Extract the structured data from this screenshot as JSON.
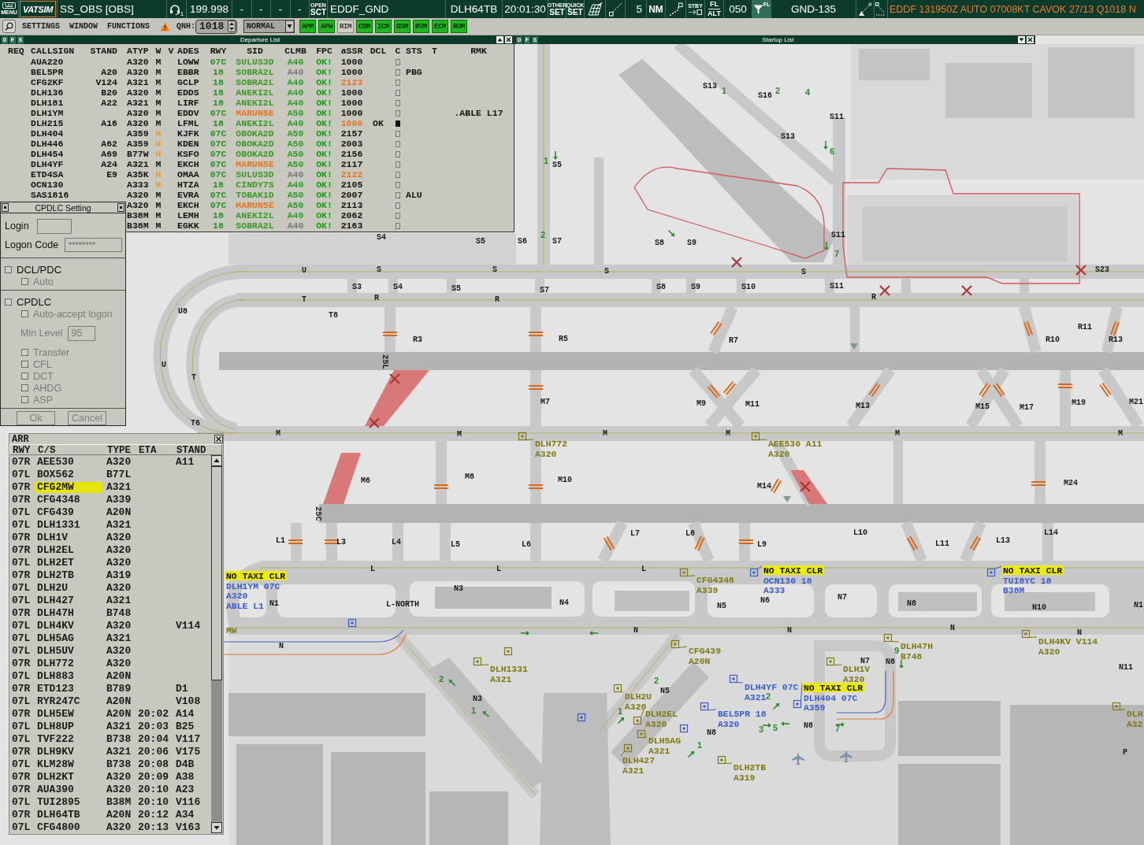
{
  "top_bar": {
    "menu": "MENU",
    "logo": "VATSIM",
    "callsign": "SS_OBS [OBS]",
    "headset_index": "1",
    "frequency": "199.998",
    "slots": [
      "-",
      "-",
      "-",
      "-"
    ],
    "sector": [
      "OPEN",
      "SCT"
    ],
    "position": "EDDF_GND",
    "aircraft": "DLH64TB",
    "clock": "20:01:30",
    "other_set": [
      "OTHER",
      "SET"
    ],
    "quick_set": [
      "QUICK",
      "SET"
    ],
    "range": "5",
    "range_unit": "NM",
    "standby": "STBY",
    "altitude_mode": [
      "FL",
      "ALT"
    ],
    "filter_level": "050",
    "filter_label": "FL",
    "filter_active": true,
    "atc_station": "GND-135",
    "metar": "EDDF 131950Z AUTO 07008KT CAVOK 27/13 Q1018 N"
  },
  "toolbar": {
    "menus": [
      "SETTINGS",
      "WINDOW",
      "FUNCTIONS"
    ],
    "qnh_label": "QNH:",
    "qnh": "1018",
    "mode": "NORMAL",
    "toggles": [
      {
        "label": "APM",
        "on": true
      },
      {
        "label": "APW",
        "on": true
      },
      {
        "label": "RIM",
        "on": false
      },
      {
        "label": "CBM",
        "on": true
      },
      {
        "label": "ICM",
        "on": true
      },
      {
        "label": "OSM",
        "on": true
      },
      {
        "label": "RVM",
        "on": true
      },
      {
        "label": "ECM",
        "on": true
      },
      {
        "label": "RUM",
        "on": true
      }
    ]
  },
  "departure_list": {
    "flags": [
      "O",
      "F",
      "S"
    ],
    "title": "Departure List",
    "collapsed": false,
    "columns": [
      "REQ",
      "CALLSIGN",
      "STAND",
      "ATYP",
      "W",
      "V",
      "ADES",
      "RWY",
      "SID",
      "CLMB",
      "FPC",
      "aSSR",
      "DCL",
      "C",
      "STS",
      "T",
      "RMK"
    ],
    "rows": [
      {
        "callsign": "AUA220",
        "atyp": "A320",
        "wtc": "M",
        "ades": "LOWW",
        "rwy": "07C",
        "sid": "SULUS3D",
        "climb": "A40",
        "fpc": "OK!",
        "squawk": "1000",
        "wtc_alert": false,
        "sid_alert": false,
        "climb_dim": false,
        "squawk_alert": false,
        "cleared": false
      },
      {
        "callsign": "BEL5PR",
        "stand": "A20",
        "atyp": "A320",
        "wtc": "M",
        "ades": "EBBR",
        "rwy": "18",
        "sid": "SOBRA2L",
        "climb": "A40",
        "fpc": "OK!",
        "squawk": "1000",
        "sts": "PBG",
        "wtc_alert": false,
        "sid_alert": false,
        "climb_dim": true,
        "squawk_alert": false,
        "cleared": false
      },
      {
        "callsign": "CFG2KF",
        "stand": "V124",
        "atyp": "A321",
        "wtc": "M",
        "ades": "GCLP",
        "rwy": "18",
        "sid": "SOBRA2L",
        "climb": "A40",
        "fpc": "OK!",
        "squawk": "2123",
        "wtc_alert": false,
        "sid_alert": false,
        "climb_dim": false,
        "squawk_alert": true,
        "cleared": false
      },
      {
        "callsign": "DLH136",
        "stand": "B20",
        "atyp": "A320",
        "wtc": "M",
        "ades": "EDDS",
        "rwy": "18",
        "sid": "ANEKI2L",
        "climb": "A40",
        "fpc": "OK!",
        "squawk": "1000",
        "wtc_alert": false,
        "sid_alert": false,
        "climb_dim": false,
        "squawk_alert": false,
        "cleared": false
      },
      {
        "callsign": "DLH181",
        "stand": "A22",
        "atyp": "A321",
        "wtc": "M",
        "ades": "LIRF",
        "rwy": "18",
        "sid": "ANEKI2L",
        "climb": "A40",
        "fpc": "OK!",
        "squawk": "1000",
        "wtc_alert": false,
        "sid_alert": false,
        "climb_dim": false,
        "squawk_alert": false,
        "cleared": false
      },
      {
        "callsign": "DLH1YM",
        "atyp": "A320",
        "wtc": "M",
        "ades": "EDDV",
        "rwy": "07C",
        "sid": "MARUN5E",
        "climb": "A50",
        "fpc": "OK!",
        "squawk": "1000",
        "rmk": ".ABLE L17",
        "wtc_alert": false,
        "sid_alert": true,
        "climb_dim": false,
        "squawk_alert": false,
        "cleared": false
      },
      {
        "callsign": "DLH215",
        "stand": "A16",
        "atyp": "A320",
        "wtc": "M",
        "ades": "LFML",
        "rwy": "18",
        "sid": "ANEKI2L",
        "climb": "A40",
        "fpc": "OK!",
        "squawk": "1000",
        "dcl": "OK",
        "wtc_alert": false,
        "sid_alert": false,
        "climb_dim": false,
        "squawk_alert": true,
        "cleared": true
      },
      {
        "callsign": "DLH404",
        "atyp": "A359",
        "wtc": "H",
        "ades": "KJFK",
        "rwy": "07C",
        "sid": "OBOKA2D",
        "climb": "A50",
        "fpc": "OK!",
        "squawk": "2157",
        "wtc_alert": true,
        "sid_alert": false,
        "climb_dim": false,
        "squawk_alert": false,
        "cleared": false
      },
      {
        "callsign": "DLH446",
        "stand": "A62",
        "atyp": "A359",
        "wtc": "H",
        "ades": "KDEN",
        "rwy": "07C",
        "sid": "OBOKA2D",
        "climb": "A50",
        "fpc": "OK!",
        "squawk": "2003",
        "wtc_alert": true,
        "sid_alert": false,
        "climb_dim": false,
        "squawk_alert": false,
        "cleared": false
      },
      {
        "callsign": "DLH454",
        "stand": "A69",
        "atyp": "B77W",
        "wtc": "H",
        "ades": "KSFO",
        "rwy": "07C",
        "sid": "OBOKA2D",
        "climb": "A50",
        "fpc": "OK!",
        "squawk": "2156",
        "wtc_alert": true,
        "sid_alert": false,
        "climb_dim": false,
        "squawk_alert": false,
        "cleared": false
      },
      {
        "callsign": "DLH4YF",
        "stand": "A24",
        "atyp": "A321",
        "wtc": "M",
        "ades": "EKCH",
        "rwy": "07C",
        "sid": "MARUN5E",
        "climb": "A50",
        "fpc": "OK!",
        "squawk": "2117",
        "wtc_alert": false,
        "sid_alert": true,
        "climb_dim": false,
        "squawk_alert": false,
        "cleared": false
      },
      {
        "callsign": "ETD4SA",
        "stand": "E9",
        "atyp": "A35K",
        "wtc": "H",
        "ades": "OMAA",
        "rwy": "07C",
        "sid": "SULUS3D",
        "climb": "A40",
        "fpc": "OK!",
        "squawk": "2122",
        "wtc_alert": true,
        "sid_alert": false,
        "climb_dim": true,
        "squawk_alert": true,
        "cleared": false
      },
      {
        "callsign": "OCN130",
        "atyp": "A333",
        "wtc": "H",
        "ades": "HTZA",
        "rwy": "18",
        "sid": "CINDY7S",
        "climb": "A40",
        "fpc": "OK!",
        "squawk": "2105",
        "wtc_alert": true,
        "sid_alert": false,
        "climb_dim": false,
        "squawk_alert": false,
        "cleared": false
      },
      {
        "callsign": "SAS1816",
        "atyp": "A320",
        "wtc": "M",
        "ades": "EVRA",
        "rwy": "07C",
        "sid": "TOBAK1D",
        "climb": "A50",
        "fpc": "OK!",
        "squawk": "2007",
        "sts": "ALU",
        "wtc_alert": false,
        "sid_alert": false,
        "climb_dim": false,
        "squawk_alert": false,
        "cleared": false
      },
      {
        "atyp": "A320",
        "wtc": "M",
        "ades": "EKCH",
        "rwy": "07C",
        "sid": "MARUN5E",
        "climb": "A50",
        "fpc": "OK!",
        "squawk": "2113",
        "wtc_alert": false,
        "sid_alert": true,
        "climb_dim": false,
        "squawk_alert": false,
        "cleared": false
      },
      {
        "atyp": "B38M",
        "wtc": "M",
        "ades": "LEMH",
        "rwy": "18",
        "sid": "ANEKI2L",
        "climb": "A40",
        "fpc": "OK!",
        "squawk": "2062",
        "wtc_alert": false,
        "sid_alert": false,
        "climb_dim": false,
        "squawk_alert": false,
        "cleared": false
      },
      {
        "atyp": "B38M",
        "wtc": "M",
        "ades": "EGKK",
        "rwy": "18",
        "sid": "SOBRA2L",
        "climb": "A40",
        "fpc": "OK!",
        "squawk": "2163",
        "wtc_alert": false,
        "sid_alert": false,
        "climb_dim": true,
        "squawk_alert": false,
        "cleared": false
      }
    ]
  },
  "startup_list": {
    "flags": [
      "O",
      "F",
      "S"
    ],
    "title": "Startup List",
    "collapsed": true
  },
  "cpdlc_setting": {
    "title": "CPDLC Setting",
    "login_label": "Login",
    "logon_code_label": "Logon Code",
    "logon_code": "********",
    "options": [
      {
        "kind": "checkbox",
        "label": "DCL/PDC",
        "checked": false,
        "disabled": false,
        "children": [
          {
            "kind": "checkbox",
            "label": "Auto",
            "checked": false,
            "disabled": true
          }
        ]
      },
      {
        "kind": "checkbox",
        "label": "CPDLC",
        "checked": false,
        "disabled": false,
        "children": [
          {
            "kind": "checkbox",
            "label": "Auto-accept logon",
            "checked": false,
            "disabled": true
          },
          {
            "kind": "field",
            "label": "Min Level",
            "value": "95",
            "disabled": true
          },
          {
            "kind": "checkbox",
            "label": "Transfer",
            "checked": false,
            "disabled": true
          },
          {
            "kind": "checkbox",
            "label": "CFL",
            "checked": false,
            "disabled": true
          },
          {
            "kind": "checkbox",
            "label": "DCT",
            "checked": false,
            "disabled": true
          },
          {
            "kind": "checkbox",
            "label": "AHDG",
            "checked": false,
            "disabled": true
          },
          {
            "kind": "checkbox",
            "label": "ASP",
            "checked": false,
            "disabled": true
          }
        ]
      }
    ],
    "buttons": [
      "Ok",
      "Cancel"
    ]
  },
  "arrival_list": {
    "title": "ARR",
    "columns": [
      "RWY",
      "C/S",
      "TYPE",
      "ETA",
      "STAND"
    ],
    "rows": [
      {
        "rwy": "07R",
        "callsign": "AEE530",
        "type": "A320",
        "stand": "A11",
        "selected": false
      },
      {
        "rwy": "07L",
        "callsign": "BOX562",
        "type": "B77L",
        "selected": false
      },
      {
        "rwy": "07R",
        "callsign": "CFG2MW",
        "type": "A321",
        "selected": true
      },
      {
        "rwy": "07R",
        "callsign": "CFG4348",
        "type": "A339",
        "selected": false
      },
      {
        "rwy": "07L",
        "callsign": "CFG439",
        "type": "A20N",
        "selected": false
      },
      {
        "rwy": "07L",
        "callsign": "DLH1331",
        "type": "A321",
        "selected": false
      },
      {
        "rwy": "07R",
        "callsign": "DLH1V",
        "type": "A320",
        "selected": false
      },
      {
        "rwy": "07R",
        "callsign": "DLH2EL",
        "type": "A320",
        "selected": false
      },
      {
        "rwy": "07L",
        "callsign": "DLH2ET",
        "type": "A320",
        "selected": false
      },
      {
        "rwy": "07R",
        "callsign": "DLH2TB",
        "type": "A319",
        "selected": false
      },
      {
        "rwy": "07L",
        "callsign": "DLH2U",
        "type": "A320",
        "selected": false
      },
      {
        "rwy": "07L",
        "callsign": "DLH427",
        "type": "A321",
        "selected": false
      },
      {
        "rwy": "07R",
        "callsign": "DLH47H",
        "type": "B748",
        "selected": false
      },
      {
        "rwy": "07L",
        "callsign": "DLH4KV",
        "type": "A320",
        "stand": "V114",
        "selected": false
      },
      {
        "rwy": "07L",
        "callsign": "DLH5AG",
        "type": "A321",
        "selected": false
      },
      {
        "rwy": "07L",
        "callsign": "DLH5UV",
        "type": "A320",
        "selected": false
      },
      {
        "rwy": "07R",
        "callsign": "DLH772",
        "type": "A320",
        "selected": false
      },
      {
        "rwy": "07L",
        "callsign": "DLH883",
        "type": "A20N",
        "selected": false
      },
      {
        "rwy": "07R",
        "callsign": "ETD123",
        "type": "B789",
        "stand": "D1",
        "selected": false
      },
      {
        "rwy": "07L",
        "callsign": "RYR247C",
        "type": "A20N",
        "stand": "V108",
        "selected": false
      },
      {
        "rwy": "07R",
        "callsign": "DLH5EW",
        "type": "A20N",
        "eta": "20:02",
        "stand": "A14",
        "selected": false
      },
      {
        "rwy": "07L",
        "callsign": "DLH8UP",
        "type": "A321",
        "eta": "20:03",
        "stand": "B25",
        "selected": false
      },
      {
        "rwy": "07L",
        "callsign": "TVF222",
        "type": "B738",
        "eta": "20:04",
        "stand": "V117",
        "selected": false
      },
      {
        "rwy": "07R",
        "callsign": "DLH9KV",
        "type": "A321",
        "eta": "20:06",
        "stand": "V175",
        "selected": false
      },
      {
        "rwy": "07L",
        "callsign": "KLM28W",
        "type": "B738",
        "eta": "20:08",
        "stand": "D4B",
        "selected": false
      },
      {
        "rwy": "07R",
        "callsign": "DLH2KT",
        "type": "A320",
        "eta": "20:09",
        "stand": "A38",
        "selected": false
      },
      {
        "rwy": "07R",
        "callsign": "AUA390",
        "type": "A320",
        "eta": "20:10",
        "stand": "A23",
        "selected": false
      },
      {
        "rwy": "07L",
        "callsign": "TUI2895",
        "type": "B38M",
        "eta": "20:10",
        "stand": "V116",
        "selected": false
      },
      {
        "rwy": "07R",
        "callsign": "DLH64TB",
        "type": "A20N",
        "eta": "20:12",
        "stand": "A34",
        "selected": false
      },
      {
        "rwy": "07L",
        "callsign": "CFG4800",
        "type": "A320",
        "eta": "20:13",
        "stand": "V163",
        "selected": false
      }
    ]
  },
  "map": {
    "labels": [
      {
        "text": "S13",
        "kind": "taxiway"
      },
      {
        "text": "1",
        "kind": "route"
      },
      {
        "text": "S16",
        "kind": "taxiway"
      },
      {
        "text": "2",
        "kind": "route"
      },
      {
        "text": "4",
        "kind": "route"
      },
      {
        "text": "S11",
        "kind": "taxiway"
      },
      {
        "text": "S13",
        "kind": "taxiway"
      },
      {
        "text": "6",
        "kind": "route"
      },
      {
        "text": "1",
        "kind": "route"
      },
      {
        "text": "S5",
        "kind": "taxiway"
      },
      {
        "text": "2",
        "kind": "route"
      },
      {
        "text": "S11",
        "kind": "taxiway"
      },
      {
        "text": "7",
        "kind": "route"
      },
      {
        "text": "S4",
        "kind": "taxiway"
      },
      {
        "text": "S5",
        "kind": "taxiway"
      },
      {
        "text": "S6",
        "kind": "taxiway"
      },
      {
        "text": "S7",
        "kind": "taxiway"
      },
      {
        "text": "S8",
        "kind": "taxiway"
      },
      {
        "text": "S9",
        "kind": "taxiway"
      },
      {
        "text": "U",
        "kind": "taxiway"
      },
      {
        "text": "S",
        "kind": "taxiway"
      },
      {
        "text": "S",
        "kind": "taxiway"
      },
      {
        "text": "S",
        "kind": "taxiway"
      },
      {
        "text": "S",
        "kind": "taxiway"
      },
      {
        "text": "S23",
        "kind": "taxiway"
      },
      {
        "text": "S3",
        "kind": "taxiway"
      },
      {
        "text": "S4",
        "kind": "taxiway"
      },
      {
        "text": "S5",
        "kind": "taxiway"
      },
      {
        "text": "S7",
        "kind": "taxiway"
      },
      {
        "text": "S8",
        "kind": "taxiway"
      },
      {
        "text": "S9",
        "kind": "taxiway"
      },
      {
        "text": "S10",
        "kind": "taxiway"
      },
      {
        "text": "S11",
        "kind": "taxiway"
      },
      {
        "text": "T",
        "kind": "taxiway"
      },
      {
        "text": "R",
        "kind": "taxiway"
      },
      {
        "text": "R",
        "kind": "taxiway"
      },
      {
        "text": "R",
        "kind": "taxiway"
      },
      {
        "text": "U8",
        "kind": "taxiway"
      },
      {
        "text": "T8",
        "kind": "taxiway"
      },
      {
        "text": "R3",
        "kind": "taxiway"
      },
      {
        "text": "R5",
        "kind": "taxiway"
      },
      {
        "text": "R7",
        "kind": "taxiway"
      },
      {
        "text": "R11",
        "kind": "taxiway"
      },
      {
        "text": "R10",
        "kind": "taxiway"
      },
      {
        "text": "R13",
        "kind": "taxiway"
      },
      {
        "text": "25L",
        "kind": "runway"
      },
      {
        "text": "U",
        "kind": "taxiway"
      },
      {
        "text": "T",
        "kind": "taxiway"
      },
      {
        "text": "M7",
        "kind": "taxiway"
      },
      {
        "text": "M9",
        "kind": "taxiway"
      },
      {
        "text": "M11",
        "kind": "taxiway"
      },
      {
        "text": "M13",
        "kind": "taxiway"
      },
      {
        "text": "M15",
        "kind": "taxiway"
      },
      {
        "text": "M17",
        "kind": "taxiway"
      },
      {
        "text": "M19",
        "kind": "taxiway"
      },
      {
        "text": "M21",
        "kind": "taxiway"
      },
      {
        "text": "T6",
        "kind": "taxiway"
      },
      {
        "text": "M",
        "kind": "taxiway"
      },
      {
        "text": "M",
        "kind": "taxiway"
      },
      {
        "text": "M",
        "kind": "taxiway"
      },
      {
        "text": "M",
        "kind": "taxiway"
      },
      {
        "text": "M",
        "kind": "taxiway"
      },
      {
        "text": "M",
        "kind": "taxiway"
      },
      {
        "text": "M6",
        "kind": "taxiway"
      },
      {
        "text": "M8",
        "kind": "taxiway"
      },
      {
        "text": "M10",
        "kind": "taxiway"
      },
      {
        "text": "M14",
        "kind": "taxiway"
      },
      {
        "text": "M24",
        "kind": "taxiway"
      },
      {
        "text": "25C",
        "kind": "runway"
      },
      {
        "text": "L1",
        "kind": "taxiway"
      },
      {
        "text": "L3",
        "kind": "taxiway"
      },
      {
        "text": "L4",
        "kind": "taxiway"
      },
      {
        "text": "L5",
        "kind": "taxiway"
      },
      {
        "text": "L6",
        "kind": "taxiway"
      },
      {
        "text": "L7",
        "kind": "taxiway"
      },
      {
        "text": "L8",
        "kind": "taxiway"
      },
      {
        "text": "L9",
        "kind": "taxiway"
      },
      {
        "text": "L10",
        "kind": "taxiway"
      },
      {
        "text": "L11",
        "kind": "taxiway"
      },
      {
        "text": "L13",
        "kind": "taxiway"
      },
      {
        "text": "L14",
        "kind": "taxiway"
      },
      {
        "text": "L",
        "kind": "taxiway"
      },
      {
        "text": "L",
        "kind": "taxiway"
      },
      {
        "text": "L",
        "kind": "taxiway"
      },
      {
        "text": "N1",
        "kind": "taxiway"
      },
      {
        "text": "L-NORTH",
        "kind": "taxiway"
      },
      {
        "text": "N3",
        "kind": "taxiway"
      },
      {
        "text": "N4",
        "kind": "taxiway"
      },
      {
        "text": "N5",
        "kind": "taxiway"
      },
      {
        "text": "N6",
        "kind": "taxiway"
      },
      {
        "text": "N7",
        "kind": "taxiway"
      },
      {
        "text": "N8",
        "kind": "taxiway"
      },
      {
        "text": "N10",
        "kind": "taxiway"
      },
      {
        "text": "N1",
        "kind": "taxiway"
      },
      {
        "text": "N",
        "kind": "taxiway"
      },
      {
        "text": "N",
        "kind": "taxiway"
      },
      {
        "text": "N",
        "kind": "taxiway"
      },
      {
        "text": "N",
        "kind": "taxiway"
      },
      {
        "text": "N",
        "kind": "taxiway"
      },
      {
        "text": "N7",
        "kind": "taxiway"
      },
      {
        "text": "N8",
        "kind": "taxiway"
      },
      {
        "text": "N11",
        "kind": "taxiway"
      },
      {
        "text": "N5",
        "kind": "taxiway"
      },
      {
        "text": "2",
        "kind": "route"
      },
      {
        "text": "N3",
        "kind": "taxiway"
      },
      {
        "text": "1",
        "kind": "route"
      },
      {
        "text": "2",
        "kind": "route"
      },
      {
        "text": "1",
        "kind": "route"
      },
      {
        "text": "N8",
        "kind": "taxiway"
      },
      {
        "text": "N8",
        "kind": "taxiway"
      },
      {
        "text": "3",
        "kind": "route"
      },
      {
        "text": "5",
        "kind": "route"
      },
      {
        "text": "7",
        "kind": "route"
      },
      {
        "text": "1",
        "kind": "route"
      },
      {
        "text": "2",
        "kind": "route"
      },
      {
        "text": "9",
        "kind": "route"
      },
      {
        "text": "P",
        "kind": "taxiway"
      }
    ],
    "aircraft": [
      {
        "kind": "arrival",
        "lines": [
          "DLH772",
          "A320"
        ]
      },
      {
        "kind": "arrival",
        "lines": [
          "AEE530 A11",
          "A320"
        ]
      },
      {
        "kind": "departure",
        "alert": "NO TAXI CLR",
        "lines": [
          "DLH1YM 07C",
          "A320",
          "ABLE L1"
        ]
      },
      {
        "kind": "arrival",
        "lines": [
          "CFG4348",
          "A339"
        ]
      },
      {
        "kind": "departure",
        "alert": "NO TAXI CLR",
        "lines": [
          "OCN130 18",
          "A333"
        ]
      },
      {
        "kind": "departure",
        "alert": "NO TAXI CLR",
        "lines": [
          "TUI8YC 18",
          "B38M"
        ]
      },
      {
        "kind": "arrival",
        "lines": [
          "MW"
        ]
      },
      {
        "kind": "arrival",
        "lines": [
          "CFG439",
          "A20N"
        ]
      },
      {
        "kind": "arrival",
        "lines": [
          "DLH47H",
          "B748"
        ]
      },
      {
        "kind": "arrival",
        "lines": [
          "DLH4KV V114",
          "A320"
        ]
      },
      {
        "kind": "arrival",
        "lines": [
          "DLH1331",
          "A321"
        ]
      },
      {
        "kind": "arrival",
        "lines": [
          "DLH1V",
          "A320"
        ]
      },
      {
        "kind": "arrival",
        "lines": [
          "DLH2U",
          "A320"
        ]
      },
      {
        "kind": "departure",
        "lines": [
          "DLH4YF 07C",
          "A321"
        ]
      },
      {
        "kind": "departure",
        "alert": "NO TAXI CLR",
        "lines": [
          "DLH404 07C",
          "A359"
        ]
      },
      {
        "kind": "arrival",
        "lines": [
          "DLH2EL",
          "A320"
        ]
      },
      {
        "kind": "departure",
        "lines": [
          "BEL5PR 18",
          "A320"
        ]
      },
      {
        "kind": "arrival",
        "lines": [
          "DLH",
          "A32"
        ]
      },
      {
        "kind": "arrival",
        "lines": [
          "DLH5AG",
          "A321"
        ]
      },
      {
        "kind": "arrival",
        "lines": [
          "DLH427",
          "A321"
        ]
      },
      {
        "kind": "arrival",
        "lines": [
          "DLH2TB",
          "A319"
        ]
      }
    ]
  }
}
